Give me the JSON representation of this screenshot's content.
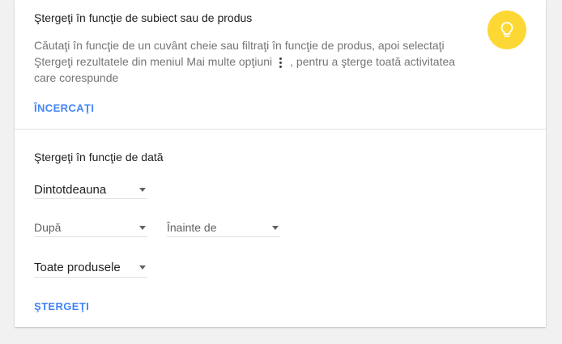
{
  "topic_section": {
    "title": "Ştergeţi în funcţie de subiect sau de produs",
    "desc_line1": "Căutaţi în funcţie de un cuvânt cheie sau filtraţi în funcţie de produs, apoi selectaţi",
    "desc_line2_before": "Ştergeţi rezultatele din meniul Mai multe opţiuni",
    "desc_line2_after": ", pentru a şterge toată activitatea",
    "desc_line3": "care corespunde",
    "try_label": "ÎNCERCAŢI",
    "icon": "lightbulb-icon",
    "menu_icon": "more-vert-icon",
    "accent_color": "#fdd835"
  },
  "date_section": {
    "title": "Ştergeţi în funcţie de dată",
    "range_select": "Dintotdeauna",
    "after_select": "După",
    "before_select": "Înainte de",
    "products_select": "Toate produsele",
    "delete_label": "ŞTERGEŢI"
  },
  "colors": {
    "link": "#4285f4",
    "background": "#f1f1f1",
    "card": "#ffffff"
  }
}
